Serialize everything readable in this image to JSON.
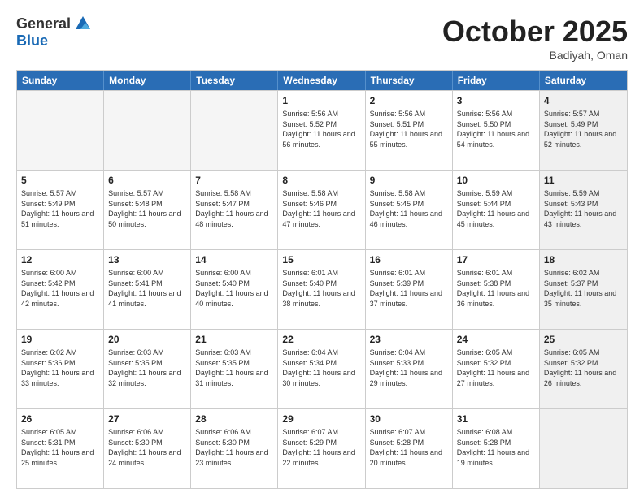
{
  "logo": {
    "general": "General",
    "blue": "Blue"
  },
  "title": "October 2025",
  "location": "Badiyah, Oman",
  "days_of_week": [
    "Sunday",
    "Monday",
    "Tuesday",
    "Wednesday",
    "Thursday",
    "Friday",
    "Saturday"
  ],
  "rows": [
    [
      {
        "day": "",
        "text": "",
        "empty": true
      },
      {
        "day": "",
        "text": "",
        "empty": true
      },
      {
        "day": "",
        "text": "",
        "empty": true
      },
      {
        "day": "1",
        "text": "Sunrise: 5:56 AM\nSunset: 5:52 PM\nDaylight: 11 hours and 56 minutes.",
        "empty": false
      },
      {
        "day": "2",
        "text": "Sunrise: 5:56 AM\nSunset: 5:51 PM\nDaylight: 11 hours and 55 minutes.",
        "empty": false
      },
      {
        "day": "3",
        "text": "Sunrise: 5:56 AM\nSunset: 5:50 PM\nDaylight: 11 hours and 54 minutes.",
        "empty": false
      },
      {
        "day": "4",
        "text": "Sunrise: 5:57 AM\nSunset: 5:49 PM\nDaylight: 11 hours and 52 minutes.",
        "empty": false,
        "shaded": true
      }
    ],
    [
      {
        "day": "5",
        "text": "Sunrise: 5:57 AM\nSunset: 5:49 PM\nDaylight: 11 hours and 51 minutes.",
        "empty": false
      },
      {
        "day": "6",
        "text": "Sunrise: 5:57 AM\nSunset: 5:48 PM\nDaylight: 11 hours and 50 minutes.",
        "empty": false
      },
      {
        "day": "7",
        "text": "Sunrise: 5:58 AM\nSunset: 5:47 PM\nDaylight: 11 hours and 48 minutes.",
        "empty": false
      },
      {
        "day": "8",
        "text": "Sunrise: 5:58 AM\nSunset: 5:46 PM\nDaylight: 11 hours and 47 minutes.",
        "empty": false
      },
      {
        "day": "9",
        "text": "Sunrise: 5:58 AM\nSunset: 5:45 PM\nDaylight: 11 hours and 46 minutes.",
        "empty": false
      },
      {
        "day": "10",
        "text": "Sunrise: 5:59 AM\nSunset: 5:44 PM\nDaylight: 11 hours and 45 minutes.",
        "empty": false
      },
      {
        "day": "11",
        "text": "Sunrise: 5:59 AM\nSunset: 5:43 PM\nDaylight: 11 hours and 43 minutes.",
        "empty": false,
        "shaded": true
      }
    ],
    [
      {
        "day": "12",
        "text": "Sunrise: 6:00 AM\nSunset: 5:42 PM\nDaylight: 11 hours and 42 minutes.",
        "empty": false
      },
      {
        "day": "13",
        "text": "Sunrise: 6:00 AM\nSunset: 5:41 PM\nDaylight: 11 hours and 41 minutes.",
        "empty": false
      },
      {
        "day": "14",
        "text": "Sunrise: 6:00 AM\nSunset: 5:40 PM\nDaylight: 11 hours and 40 minutes.",
        "empty": false
      },
      {
        "day": "15",
        "text": "Sunrise: 6:01 AM\nSunset: 5:40 PM\nDaylight: 11 hours and 38 minutes.",
        "empty": false
      },
      {
        "day": "16",
        "text": "Sunrise: 6:01 AM\nSunset: 5:39 PM\nDaylight: 11 hours and 37 minutes.",
        "empty": false
      },
      {
        "day": "17",
        "text": "Sunrise: 6:01 AM\nSunset: 5:38 PM\nDaylight: 11 hours and 36 minutes.",
        "empty": false
      },
      {
        "day": "18",
        "text": "Sunrise: 6:02 AM\nSunset: 5:37 PM\nDaylight: 11 hours and 35 minutes.",
        "empty": false,
        "shaded": true
      }
    ],
    [
      {
        "day": "19",
        "text": "Sunrise: 6:02 AM\nSunset: 5:36 PM\nDaylight: 11 hours and 33 minutes.",
        "empty": false
      },
      {
        "day": "20",
        "text": "Sunrise: 6:03 AM\nSunset: 5:35 PM\nDaylight: 11 hours and 32 minutes.",
        "empty": false
      },
      {
        "day": "21",
        "text": "Sunrise: 6:03 AM\nSunset: 5:35 PM\nDaylight: 11 hours and 31 minutes.",
        "empty": false
      },
      {
        "day": "22",
        "text": "Sunrise: 6:04 AM\nSunset: 5:34 PM\nDaylight: 11 hours and 30 minutes.",
        "empty": false
      },
      {
        "day": "23",
        "text": "Sunrise: 6:04 AM\nSunset: 5:33 PM\nDaylight: 11 hours and 29 minutes.",
        "empty": false
      },
      {
        "day": "24",
        "text": "Sunrise: 6:05 AM\nSunset: 5:32 PM\nDaylight: 11 hours and 27 minutes.",
        "empty": false
      },
      {
        "day": "25",
        "text": "Sunrise: 6:05 AM\nSunset: 5:32 PM\nDaylight: 11 hours and 26 minutes.",
        "empty": false,
        "shaded": true
      }
    ],
    [
      {
        "day": "26",
        "text": "Sunrise: 6:05 AM\nSunset: 5:31 PM\nDaylight: 11 hours and 25 minutes.",
        "empty": false
      },
      {
        "day": "27",
        "text": "Sunrise: 6:06 AM\nSunset: 5:30 PM\nDaylight: 11 hours and 24 minutes.",
        "empty": false
      },
      {
        "day": "28",
        "text": "Sunrise: 6:06 AM\nSunset: 5:30 PM\nDaylight: 11 hours and 23 minutes.",
        "empty": false
      },
      {
        "day": "29",
        "text": "Sunrise: 6:07 AM\nSunset: 5:29 PM\nDaylight: 11 hours and 22 minutes.",
        "empty": false
      },
      {
        "day": "30",
        "text": "Sunrise: 6:07 AM\nSunset: 5:28 PM\nDaylight: 11 hours and 20 minutes.",
        "empty": false
      },
      {
        "day": "31",
        "text": "Sunrise: 6:08 AM\nSunset: 5:28 PM\nDaylight: 11 hours and 19 minutes.",
        "empty": false
      },
      {
        "day": "",
        "text": "",
        "empty": true,
        "shaded": true
      }
    ]
  ]
}
